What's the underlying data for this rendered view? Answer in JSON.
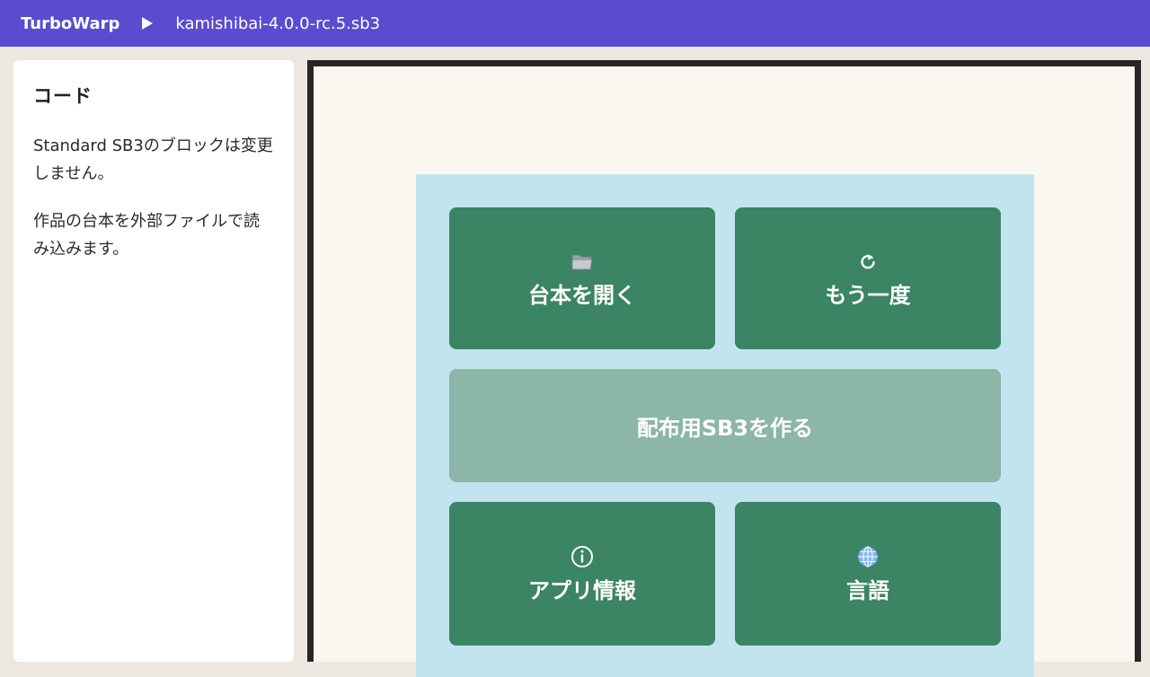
{
  "header": {
    "brand": "TurboWarp",
    "filename": "kamishibai-4.0.0-rc.5.sb3"
  },
  "sidebar": {
    "title": "コード",
    "paragraphs": [
      "Standard SB3のブロックは変更しません。",
      "作品の台本を外部ファイルで読み込みます。"
    ]
  },
  "stage": {
    "buttons": {
      "open_script": {
        "label": "台本を開く",
        "icon": "folder-icon"
      },
      "retry": {
        "label": "もう一度",
        "icon": "refresh-icon"
      },
      "make_sb3": {
        "label": "配布用SB3を作る"
      },
      "app_info": {
        "label": "アプリ情報",
        "icon": "info-icon"
      },
      "language": {
        "label": "言語",
        "icon": "globe-icon"
      }
    }
  },
  "colors": {
    "topbar": "#5a4bcf",
    "button": "#3b8464",
    "button_wide": "#8bb6a8",
    "panel": "#c2e4ef"
  }
}
